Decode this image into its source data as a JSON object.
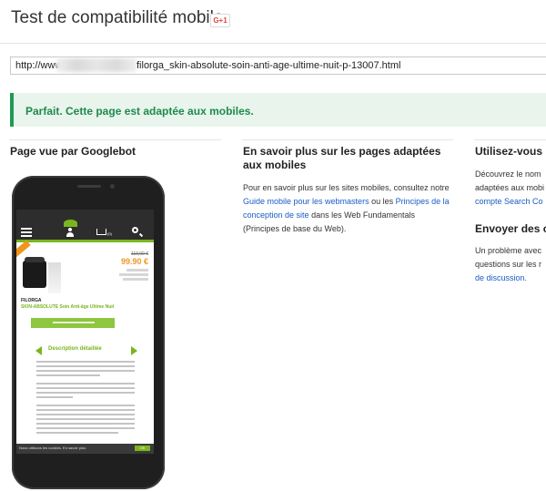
{
  "header": {
    "title": "Test de compatibilité mobile",
    "gplus_label": "G+1"
  },
  "url": {
    "prefix": "http://www",
    "suffix": "filorga_skin-absolute-soin-anti-age-ultime-nuit-p-13007.html"
  },
  "result": {
    "message": "Parfait. Cette page est adaptée aux mobiles."
  },
  "left_column": {
    "heading": "Page vue par Googlebot",
    "preview": {
      "cart_count": "(0)",
      "old_price": "119,00 €",
      "price": "99.90 €",
      "brand": "FILORGA",
      "product_name": "SKIN-ABSOLUTE Soin Anti-âge Ultime Nuit",
      "description_heading": "Description détaillée",
      "cookie_text": "Nous utilisons les cookies. En savoir plus",
      "cookie_ok": "OK"
    }
  },
  "middle_column": {
    "heading": "En savoir plus sur les pages adaptées aux mobiles",
    "p_text1": "Pour en savoir plus sur les sites mobiles, consultez notre ",
    "link1": "Guide mobile pour les webmasters",
    "p_text2": " ou les ",
    "link2": "Principes de la conception de site",
    "p_text3": " dans les Web Fundamentals (Principes de base du Web)."
  },
  "right_column": {
    "heading1": "Utilisez-vous",
    "line1": "Découvrez le nom",
    "line2": "adaptées aux mobi",
    "link_a": "compte Search Co",
    "heading2": "Envoyer des c",
    "line3": "Un problème avec",
    "line4": "questions sur les r",
    "link_b": "de discussion."
  },
  "colors": {
    "success_green": "#1e9c54",
    "link_blue": "#1a5dc4",
    "site_green": "#7ab51d",
    "price_orange": "#f0961e"
  }
}
